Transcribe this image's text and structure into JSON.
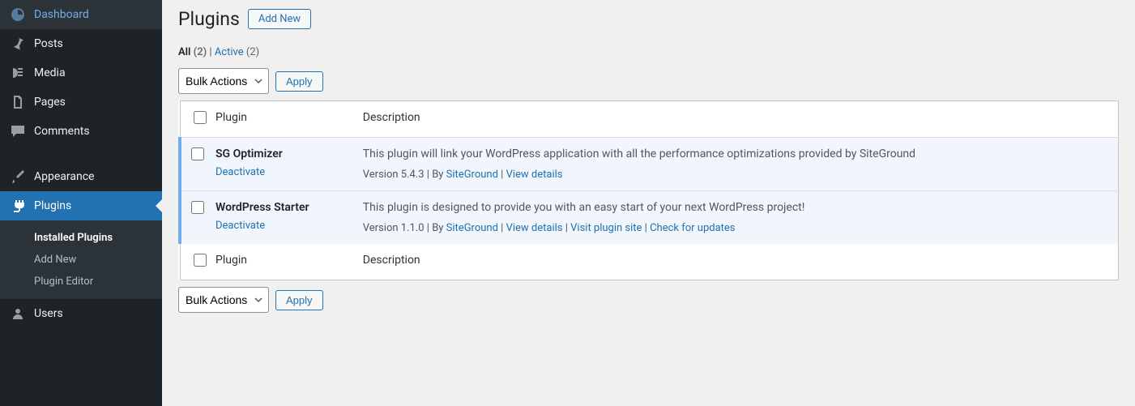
{
  "sidebar": {
    "items": [
      {
        "label": "Dashboard",
        "id": "dashboard"
      },
      {
        "label": "Posts",
        "id": "posts"
      },
      {
        "label": "Media",
        "id": "media"
      },
      {
        "label": "Pages",
        "id": "pages"
      },
      {
        "label": "Comments",
        "id": "comments"
      },
      {
        "label": "Appearance",
        "id": "appearance"
      },
      {
        "label": "Plugins",
        "id": "plugins",
        "current": true
      },
      {
        "label": "Users",
        "id": "users"
      }
    ],
    "submenu": [
      {
        "label": "Installed Plugins",
        "current": true
      },
      {
        "label": "Add New"
      },
      {
        "label": "Plugin Editor"
      }
    ]
  },
  "header": {
    "title": "Plugins",
    "add_new": "Add New"
  },
  "filters": {
    "all_label": "All",
    "all_count": "(2)",
    "active_label": "Active",
    "active_count": "(2)",
    "separator": " | "
  },
  "bulk": {
    "select_label": "Bulk Actions",
    "apply_label": "Apply"
  },
  "table": {
    "col_plugin": "Plugin",
    "col_description": "Description"
  },
  "plugins": [
    {
      "name": "SG Optimizer",
      "action": "Deactivate",
      "description": "This plugin will link your WordPress application with all the performance optimizations provided by SiteGround",
      "version_text": "Version 5.4.3",
      "by_text": "By ",
      "author": "SiteGround",
      "links": [
        "View details"
      ]
    },
    {
      "name": "WordPress Starter",
      "action": "Deactivate",
      "description": "This plugin is designed to provide you with an easy start of your next WordPress project!",
      "version_text": "Version 1.1.0",
      "by_text": "By ",
      "author": "SiteGround",
      "links": [
        "View details",
        "Visit plugin site",
        "Check for updates"
      ]
    }
  ]
}
